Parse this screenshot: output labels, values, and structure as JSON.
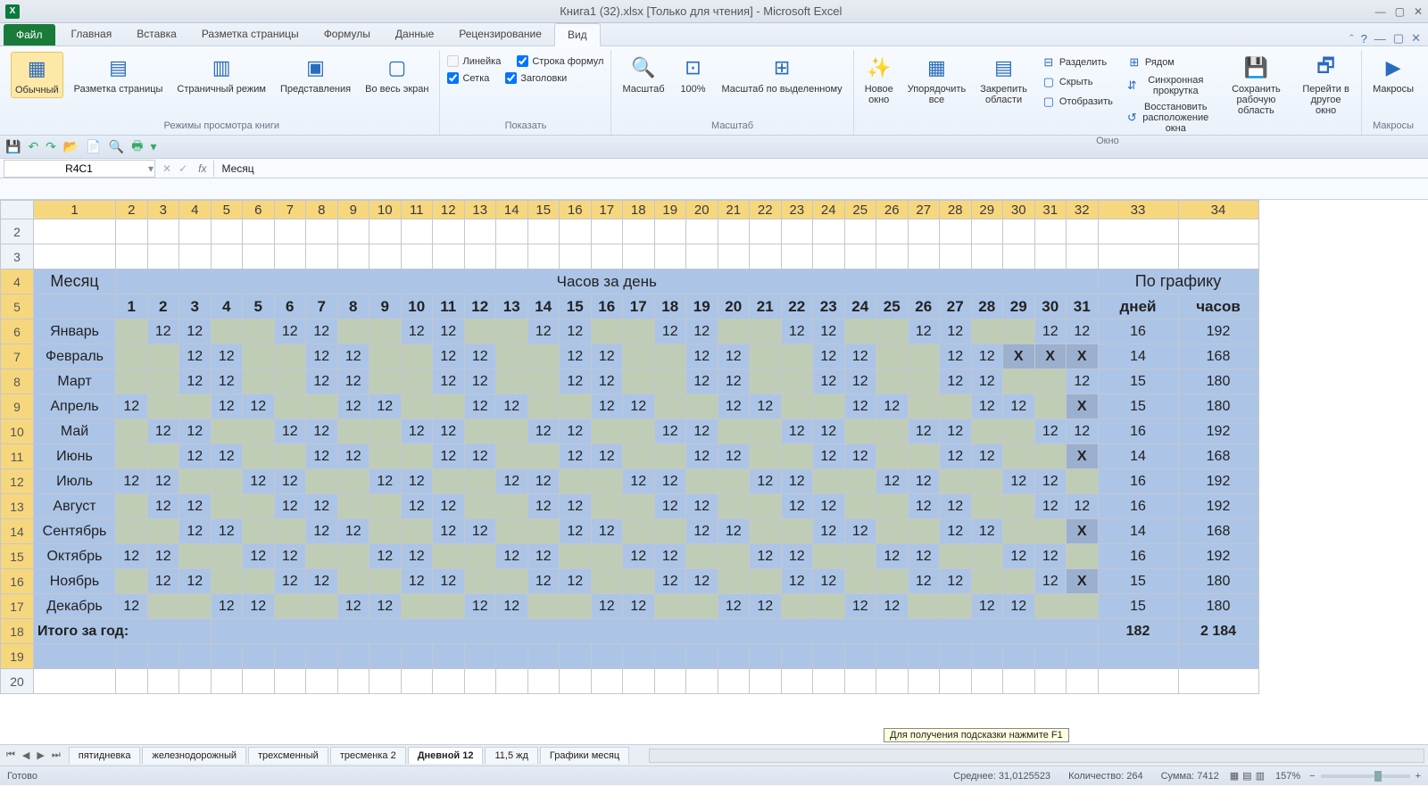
{
  "title": "Книга1 (32).xlsx  [Только для чтения]  -  Microsoft Excel",
  "file_tab": "Файл",
  "tabs": [
    "Главная",
    "Вставка",
    "Разметка страницы",
    "Формулы",
    "Данные",
    "Рецензирование",
    "Вид"
  ],
  "active_tab": 6,
  "ribbon": {
    "modes": {
      "normal": "Обычный",
      "pagelayout": "Разметка\nстраницы",
      "pagebreak": "Страничный\nрежим",
      "custom": "Представления",
      "full": "Во весь\nэкран",
      "gname": "Режимы просмотра книги"
    },
    "show": {
      "ruler": "Линейка",
      "formula": "Строка формул",
      "grid": "Сетка",
      "headings": "Заголовки",
      "gname": "Показать"
    },
    "zoom": {
      "zoom": "Масштаб",
      "z100": "100%",
      "zsel": "Масштаб по\nвыделенному",
      "gname": "Масштаб"
    },
    "window": {
      "new": "Новое\nокно",
      "arrange": "Упорядочить\nвсе",
      "freeze": "Закрепить\nобласти",
      "split": "Разделить",
      "hide": "Скрыть",
      "unhide": "Отобразить",
      "side": "Рядом",
      "sync": "Синхронная прокрутка",
      "reset": "Восстановить расположение окна",
      "save": "Сохранить\nрабочую область",
      "switch": "Перейти в\nдругое окно",
      "gname": "Окно"
    },
    "macros": {
      "macros": "Макросы",
      "gname": "Макросы"
    }
  },
  "namebox": "R4C1",
  "fx": "Месяц",
  "cols_n": [
    "1",
    "2",
    "3",
    "4",
    "5",
    "6",
    "7",
    "8",
    "9",
    "10",
    "11",
    "12",
    "13",
    "14",
    "15",
    "16",
    "17",
    "18",
    "19",
    "20",
    "21",
    "22",
    "23",
    "24",
    "25",
    "26",
    "27",
    "28",
    "29",
    "30",
    "31",
    "32",
    "33",
    "34"
  ],
  "header": {
    "month": "Месяц",
    "hours": "Часов за день",
    "schedule": "По графику",
    "days_h": "дней",
    "hours_h": "часов"
  },
  "daynums": [
    "1",
    "2",
    "3",
    "4",
    "5",
    "6",
    "7",
    "8",
    "9",
    "10",
    "11",
    "12",
    "13",
    "14",
    "15",
    "16",
    "17",
    "18",
    "19",
    "20",
    "21",
    "22",
    "23",
    "24",
    "25",
    "26",
    "27",
    "28",
    "29",
    "30",
    "31"
  ],
  "rows": [
    {
      "r": 6,
      "m": "Январь",
      "d": [
        "",
        "12",
        "12",
        "",
        "",
        "12",
        "12",
        "",
        "",
        "12",
        "12",
        "",
        "",
        "12",
        "12",
        "",
        "",
        "12",
        "12",
        "",
        "",
        "12",
        "12",
        "",
        "",
        "12",
        "12",
        "",
        "",
        "12",
        "12"
      ],
      "days": "16",
      "hrs": "192"
    },
    {
      "r": 7,
      "m": "Февраль",
      "d": [
        "",
        "",
        "12",
        "12",
        "",
        "",
        "12",
        "12",
        "",
        "",
        "12",
        "12",
        "",
        "",
        "12",
        "12",
        "",
        "",
        "12",
        "12",
        "",
        "",
        "12",
        "12",
        "",
        "",
        "12",
        "12",
        "X",
        "X",
        "X"
      ],
      "days": "14",
      "hrs": "168"
    },
    {
      "r": 8,
      "m": "Март",
      "d": [
        "",
        "",
        "12",
        "12",
        "",
        "",
        "12",
        "12",
        "",
        "",
        "12",
        "12",
        "",
        "",
        "12",
        "12",
        "",
        "",
        "12",
        "12",
        "",
        "",
        "12",
        "12",
        "",
        "",
        "12",
        "12",
        "",
        "",
        "12"
      ],
      "days": "15",
      "hrs": "180"
    },
    {
      "r": 9,
      "m": "Апрель",
      "d": [
        "12",
        "",
        "",
        "12",
        "12",
        "",
        "",
        "12",
        "12",
        "",
        "",
        "12",
        "12",
        "",
        "",
        "12",
        "12",
        "",
        "",
        "12",
        "12",
        "",
        "",
        "12",
        "12",
        "",
        "",
        "12",
        "12",
        "",
        "X"
      ],
      "days": "15",
      "hrs": "180"
    },
    {
      "r": 10,
      "m": "Май",
      "d": [
        "",
        "12",
        "12",
        "",
        "",
        "12",
        "12",
        "",
        "",
        "12",
        "12",
        "",
        "",
        "12",
        "12",
        "",
        "",
        "12",
        "12",
        "",
        "",
        "12",
        "12",
        "",
        "",
        "12",
        "12",
        "",
        "",
        "12",
        "12"
      ],
      "days": "16",
      "hrs": "192"
    },
    {
      "r": 11,
      "m": "Июнь",
      "d": [
        "",
        "",
        "12",
        "12",
        "",
        "",
        "12",
        "12",
        "",
        "",
        "12",
        "12",
        "",
        "",
        "12",
        "12",
        "",
        "",
        "12",
        "12",
        "",
        "",
        "12",
        "12",
        "",
        "",
        "12",
        "12",
        "",
        "",
        "X"
      ],
      "days": "14",
      "hrs": "168"
    },
    {
      "r": 12,
      "m": "Июль",
      "d": [
        "12",
        "12",
        "",
        "",
        "12",
        "12",
        "",
        "",
        "12",
        "12",
        "",
        "",
        "12",
        "12",
        "",
        "",
        "12",
        "12",
        "",
        "",
        "12",
        "12",
        "",
        "",
        "12",
        "12",
        "",
        "",
        "12",
        "12",
        ""
      ],
      "days": "16",
      "hrs": "192"
    },
    {
      "r": 13,
      "m": "Август",
      "d": [
        "",
        "12",
        "12",
        "",
        "",
        "12",
        "12",
        "",
        "",
        "12",
        "12",
        "",
        "",
        "12",
        "12",
        "",
        "",
        "12",
        "12",
        "",
        "",
        "12",
        "12",
        "",
        "",
        "12",
        "12",
        "",
        "",
        "12",
        "12"
      ],
      "days": "16",
      "hrs": "192"
    },
    {
      "r": 14,
      "m": "Сентябрь",
      "d": [
        "",
        "",
        "12",
        "12",
        "",
        "",
        "12",
        "12",
        "",
        "",
        "12",
        "12",
        "",
        "",
        "12",
        "12",
        "",
        "",
        "12",
        "12",
        "",
        "",
        "12",
        "12",
        "",
        "",
        "12",
        "12",
        "",
        "",
        "X"
      ],
      "days": "14",
      "hrs": "168"
    },
    {
      "r": 15,
      "m": "Октябрь",
      "d": [
        "12",
        "12",
        "",
        "",
        "12",
        "12",
        "",
        "",
        "12",
        "12",
        "",
        "",
        "12",
        "12",
        "",
        "",
        "12",
        "12",
        "",
        "",
        "12",
        "12",
        "",
        "",
        "12",
        "12",
        "",
        "",
        "12",
        "12",
        ""
      ],
      "days": "16",
      "hrs": "192"
    },
    {
      "r": 16,
      "m": "Ноябрь",
      "d": [
        "",
        "12",
        "12",
        "",
        "",
        "12",
        "12",
        "",
        "",
        "12",
        "12",
        "",
        "",
        "12",
        "12",
        "",
        "",
        "12",
        "12",
        "",
        "",
        "12",
        "12",
        "",
        "",
        "12",
        "12",
        "",
        "",
        "12",
        "X"
      ],
      "days": "15",
      "hrs": "180"
    },
    {
      "r": 17,
      "m": "Декабрь",
      "d": [
        "12",
        "",
        "",
        "12",
        "12",
        "",
        "",
        "12",
        "12",
        "",
        "",
        "12",
        "12",
        "",
        "",
        "12",
        "12",
        "",
        "",
        "12",
        "12",
        "",
        "",
        "12",
        "12",
        "",
        "",
        "12",
        "12",
        "",
        ""
      ],
      "days": "15",
      "hrs": "180"
    }
  ],
  "total": {
    "label": "Итого за год:",
    "days": "182",
    "hrs": "2 184"
  },
  "sheets": [
    "пятидневка",
    "железнодорожный",
    "трехсменный",
    "тресменка 2",
    "Дневной 12",
    "11,5 жд",
    "Графики месяц"
  ],
  "active_sheet": 4,
  "tooltip": "Для получения подсказки нажмите F1",
  "status": {
    "ready": "Готово",
    "avg": "Среднее: 31,0125523",
    "count": "Количество: 264",
    "sum": "Сумма: 7412",
    "zoom": "157%"
  }
}
